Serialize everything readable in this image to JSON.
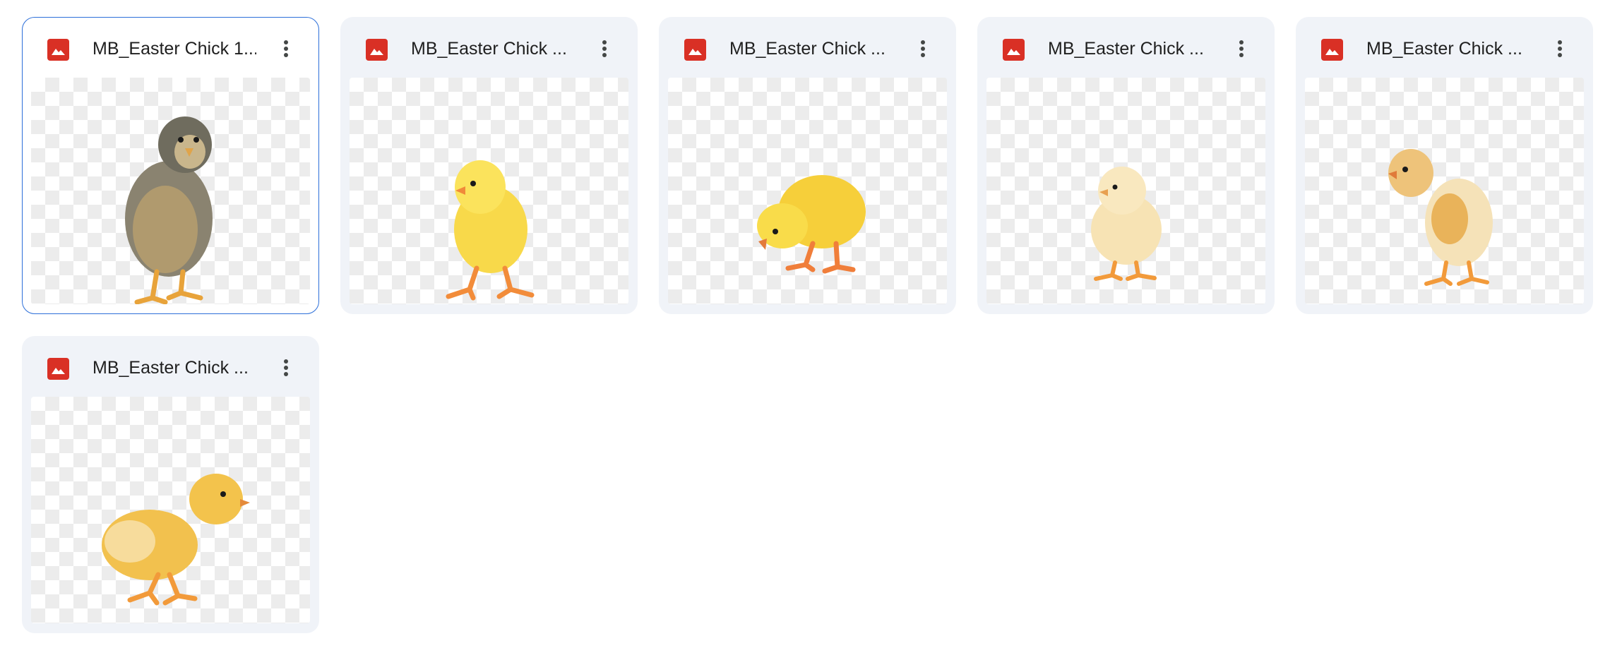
{
  "files": [
    {
      "name": "MB_Easter Chick 1...",
      "type_icon": "image-icon",
      "menu_icon": "more-vert-icon",
      "selected": true
    },
    {
      "name": "MB_Easter Chick ...",
      "type_icon": "image-icon",
      "menu_icon": "more-vert-icon",
      "selected": false
    },
    {
      "name": "MB_Easter Chick ...",
      "type_icon": "image-icon",
      "menu_icon": "more-vert-icon",
      "selected": false
    },
    {
      "name": "MB_Easter Chick ...",
      "type_icon": "image-icon",
      "menu_icon": "more-vert-icon",
      "selected": false
    },
    {
      "name": "MB_Easter Chick ...",
      "type_icon": "image-icon",
      "menu_icon": "more-vert-icon",
      "selected": false
    },
    {
      "name": "MB_Easter Chick ...",
      "type_icon": "image-icon",
      "menu_icon": "more-vert-icon",
      "selected": false
    }
  ],
  "colors": {
    "card_bg": "#f0f3f8",
    "selected_border": "#2c6fd9",
    "image_icon": "#d93025",
    "title_text": "#1f1f1f"
  }
}
